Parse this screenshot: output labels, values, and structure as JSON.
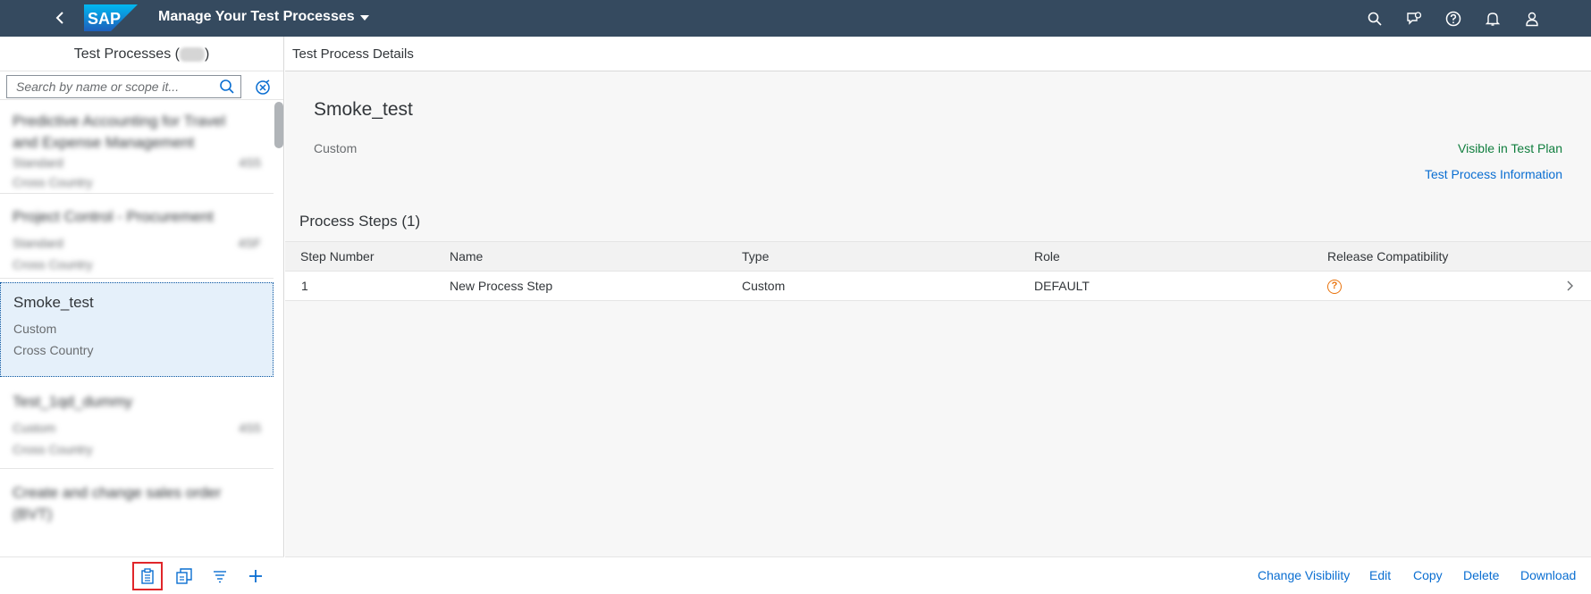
{
  "shell": {
    "title": "Manage Your Test Processes",
    "logo_text": "SAP",
    "icons": [
      "back-icon",
      "search-icon",
      "feedback-icon",
      "help-icon",
      "notifications-icon",
      "user-icon"
    ]
  },
  "master": {
    "title": "Test Processes (",
    "title_close": ")",
    "search_placeholder": "Search by name or scope it...",
    "items": [
      {
        "name": "Predictive Accounting for Travel and Expense Management",
        "type": "Standard",
        "num": "4S5",
        "scope": "Cross Country"
      },
      {
        "name": "Project Control - Procurement",
        "type": "Standard",
        "num": "4SF",
        "scope": "Cross Country"
      },
      {
        "name": "Smoke_test",
        "type": "Custom",
        "num": "",
        "scope": "Cross Country"
      },
      {
        "name": "Test_1qd_dummy",
        "type": "Custom",
        "num": "4S5",
        "scope": "Cross Country"
      },
      {
        "name": "Create and change sales order (BVT)",
        "type": "",
        "num": "",
        "scope": ""
      }
    ],
    "footer_icons": [
      "clipboard-icon",
      "copy-to-plan-icon",
      "sort-icon",
      "add-icon"
    ]
  },
  "detail": {
    "bar_title": "Test Process Details",
    "name": "Smoke_test",
    "category": "Custom",
    "visibility": "Visible in Test Plan",
    "info_link": "Test Process Information",
    "steps_title": "Process Steps (1)",
    "columns": [
      "Step Number",
      "Name",
      "Type",
      "Role",
      "Release Compatibility"
    ],
    "rows": [
      {
        "step": "1",
        "name": "New Process Step",
        "type": "Custom",
        "role": "DEFAULT",
        "compat_icon": "question-icon"
      }
    ],
    "footer_buttons": [
      "Change Visibility",
      "Edit",
      "Copy",
      "Delete",
      "Download"
    ]
  },
  "colors": {
    "shell": "#354a5f",
    "link": "#0a6ed1",
    "positive": "#107e3e",
    "warning": "#e9730c",
    "selected": "#e5f0fa",
    "highlight_box": "#e0262a"
  }
}
